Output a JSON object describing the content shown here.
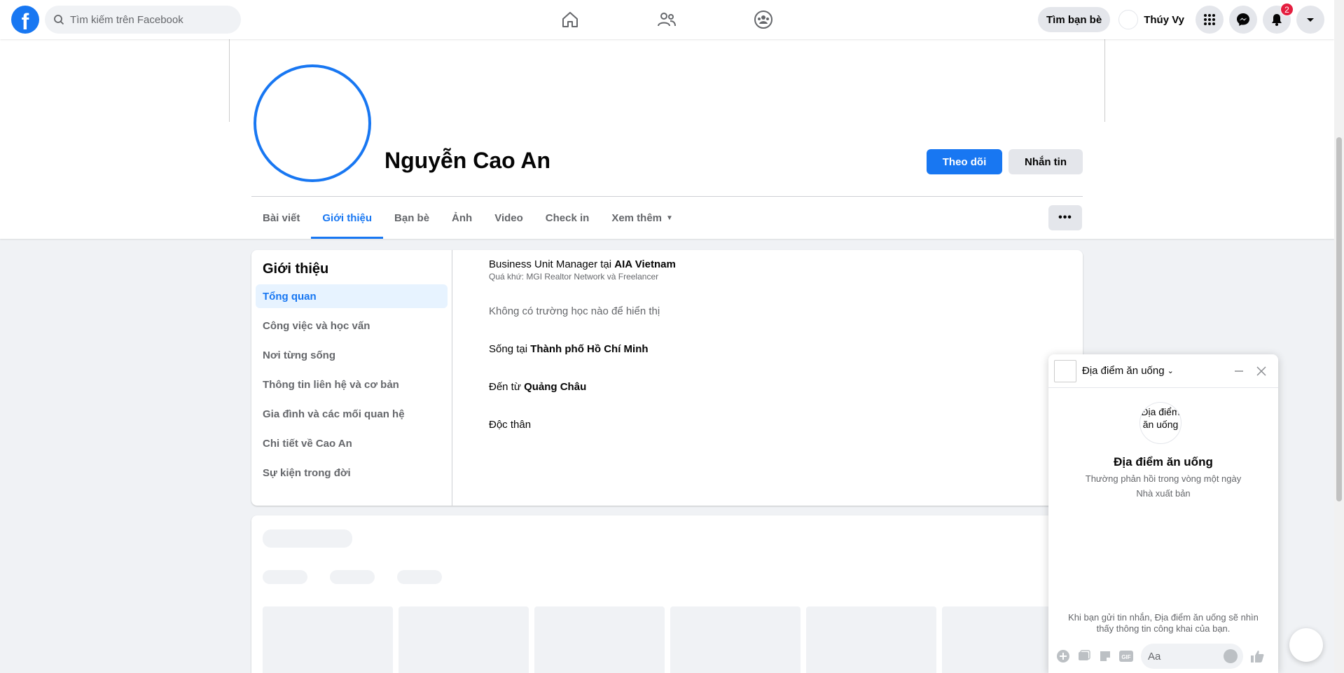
{
  "topbar": {
    "logo_letter": "f",
    "search_placeholder": "Tìm kiếm trên Facebook",
    "find_friends_label": "Tìm bạn bè",
    "user_name": "Thúy Vy",
    "notification_count": "2"
  },
  "profile": {
    "name": "Nguyễn Cao An",
    "follow_label": "Theo dõi",
    "message_label": "Nhắn tin",
    "more_label": "•••"
  },
  "tabs": [
    {
      "label": "Bài viết"
    },
    {
      "label": "Giới thiệu",
      "active": true
    },
    {
      "label": "Bạn bè"
    },
    {
      "label": "Ảnh"
    },
    {
      "label": "Video"
    },
    {
      "label": "Check in"
    },
    {
      "label": "Xem thêm"
    }
  ],
  "about": {
    "heading": "Giới thiệu",
    "menu": [
      "Tổng quan",
      "Công việc và học vấn",
      "Nơi từng sống",
      "Thông tin liên hệ và cơ bản",
      "Gia đình và các mối quan hệ",
      "Chi tiết về Cao An",
      "Sự kiện trong đời"
    ],
    "work_prefix": "Business Unit Manager tại ",
    "work_company": "AIA Vietnam",
    "work_past": "Quá khứ: MGI Realtor Network và Freelancer",
    "no_school": "Không có trường học nào để hiển thị",
    "lives_prefix": "Sống tại ",
    "lives_city": "Thành phố Hồ Chí Minh",
    "from_prefix": "Đến từ ",
    "from_city": "Quảng Châu",
    "relationship": "Độc thân"
  },
  "chat": {
    "title": "Địa điểm ăn uống",
    "avatar_alt": "Địa điểm ăn uống",
    "page_name": "Địa điểm ăn uống",
    "response_time": "Thường phản hồi trong vòng một ngày",
    "category": "Nhà xuất bản",
    "notice": "Khi bạn gửi tin nhắn, Địa điểm ăn uống sẽ nhìn thấy thông tin công khai của bạn.",
    "input_placeholder": "Aa",
    "gif_label": "GIF"
  },
  "colors": {
    "brand": "#1877f2",
    "badge": "#e41e3f"
  }
}
